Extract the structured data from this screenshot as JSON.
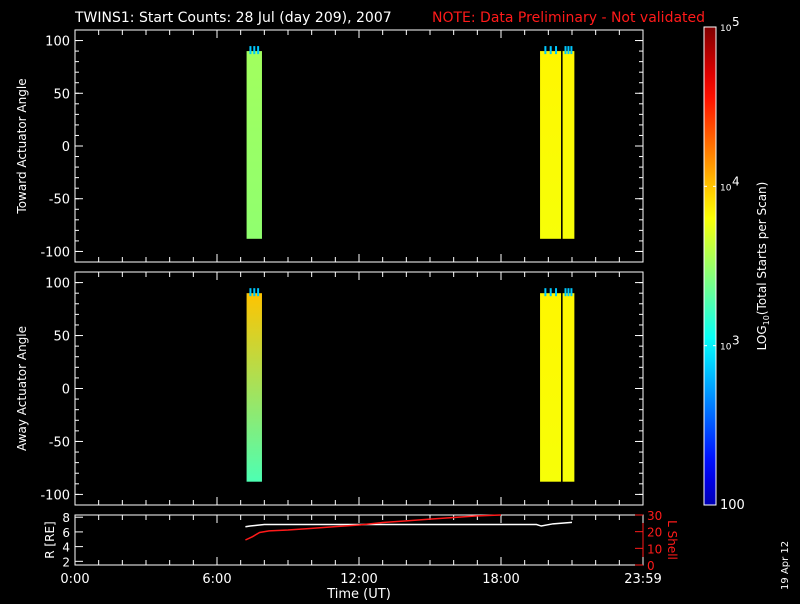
{
  "title": {
    "main": "TWINS1: Start Counts: 28 Jul (day 209), 2007",
    "note": "NOTE: Data Preliminary - Not validated",
    "note_color": "#ff1a1a"
  },
  "side_date": "19 Apr 12",
  "chart_data": [
    {
      "type": "heatmap",
      "name": "toward",
      "ylabel": "Toward Actuator Angle",
      "ylim": [
        -110,
        110
      ],
      "yticks": [
        "100",
        "50",
        "0",
        "-50",
        "-100"
      ],
      "ytick_values": [
        100,
        50,
        0,
        -50,
        -100
      ],
      "xlim_hours": [
        0,
        24
      ],
      "blocks": [
        {
          "t0": 7.25,
          "t1": 7.9,
          "a0": -88,
          "a1": 90,
          "log_counts_bottom": 3.55,
          "log_counts_top": 3.6
        },
        {
          "t0": 19.65,
          "t1": 20.55,
          "a0": -88,
          "a1": 90,
          "log_counts_bottom": 3.85,
          "log_counts_top": 3.9
        },
        {
          "t0": 20.6,
          "t1": 21.1,
          "a0": -88,
          "a1": 90,
          "log_counts_bottom": 3.85,
          "log_counts_top": 3.9
        }
      ]
    },
    {
      "type": "heatmap",
      "name": "away",
      "ylabel": "Away Actuator Angle",
      "ylim": [
        -110,
        110
      ],
      "yticks": [
        "100",
        "50",
        "0",
        "-50",
        "-100"
      ],
      "ytick_values": [
        100,
        50,
        0,
        -50,
        -100
      ],
      "xlim_hours": [
        0,
        24
      ],
      "blocks": [
        {
          "t0": 7.25,
          "t1": 7.9,
          "a0": -88,
          "a1": 90,
          "log_counts_bottom": 3.35,
          "log_counts_top": 4.05
        },
        {
          "t0": 19.65,
          "t1": 20.55,
          "a0": -88,
          "a1": 90,
          "log_counts_bottom": 3.85,
          "log_counts_top": 3.9
        },
        {
          "t0": 20.6,
          "t1": 21.1,
          "a0": -88,
          "a1": 90,
          "log_counts_bottom": 3.85,
          "log_counts_top": 3.9
        }
      ]
    },
    {
      "type": "line",
      "name": "orbit",
      "ylabel_left": "R [RE]",
      "ylabel_right": "L Shell",
      "ylim_left": [
        1.5,
        8.3
      ],
      "ylim_right": [
        0,
        30
      ],
      "yticks_left": [
        "8",
        "6",
        "4",
        "2"
      ],
      "ytick_values_left": [
        8,
        6,
        4,
        2
      ],
      "yticks_right": [
        "30",
        "20",
        "10",
        "0"
      ],
      "ytick_values_right": [
        30,
        20,
        10,
        0
      ],
      "xlabel": "Time (UT)",
      "xticks": [
        "0:00",
        "6:00",
        "12:00",
        "18:00",
        "23:59"
      ],
      "xtick_values": [
        0,
        6,
        12,
        18,
        24
      ],
      "series": [
        {
          "name": "R",
          "color": "#ffffff",
          "axis": "left",
          "x": [
            7.2,
            7.4,
            7.7,
            8.0,
            10,
            14,
            19.5,
            19.7,
            20.2,
            21.0
          ],
          "y": [
            6.7,
            6.8,
            6.9,
            7.0,
            7.0,
            7.0,
            7.0,
            6.8,
            7.1,
            7.3
          ]
        },
        {
          "name": "L Shell",
          "color": "#ff1a1a",
          "axis": "right",
          "x": [
            7.2,
            7.5,
            7.8,
            8.2,
            9.0,
            10.0,
            11.0,
            12.0,
            13.0,
            14.0,
            15.0,
            16.0,
            17.0,
            18.0
          ],
          "y": [
            15,
            17,
            19.5,
            20.5,
            21,
            22,
            23,
            24,
            25.5,
            26.5,
            27.5,
            28.5,
            29.5,
            30
          ]
        }
      ]
    }
  ],
  "colorbar": {
    "label": "LOG10(Total Starts per Scan)",
    "label_main": "LOG",
    "label_sub": "10",
    "label_rest": "(Total Starts per Scan)",
    "range_log": [
      2,
      5
    ],
    "ticks": [
      {
        "base": "10",
        "exp": "5",
        "value": 5
      },
      {
        "base": "10",
        "exp": "4",
        "value": 4
      },
      {
        "base": "10",
        "exp": "3",
        "value": 3
      },
      {
        "base": "100",
        "exp": "",
        "value": 2
      }
    ]
  }
}
